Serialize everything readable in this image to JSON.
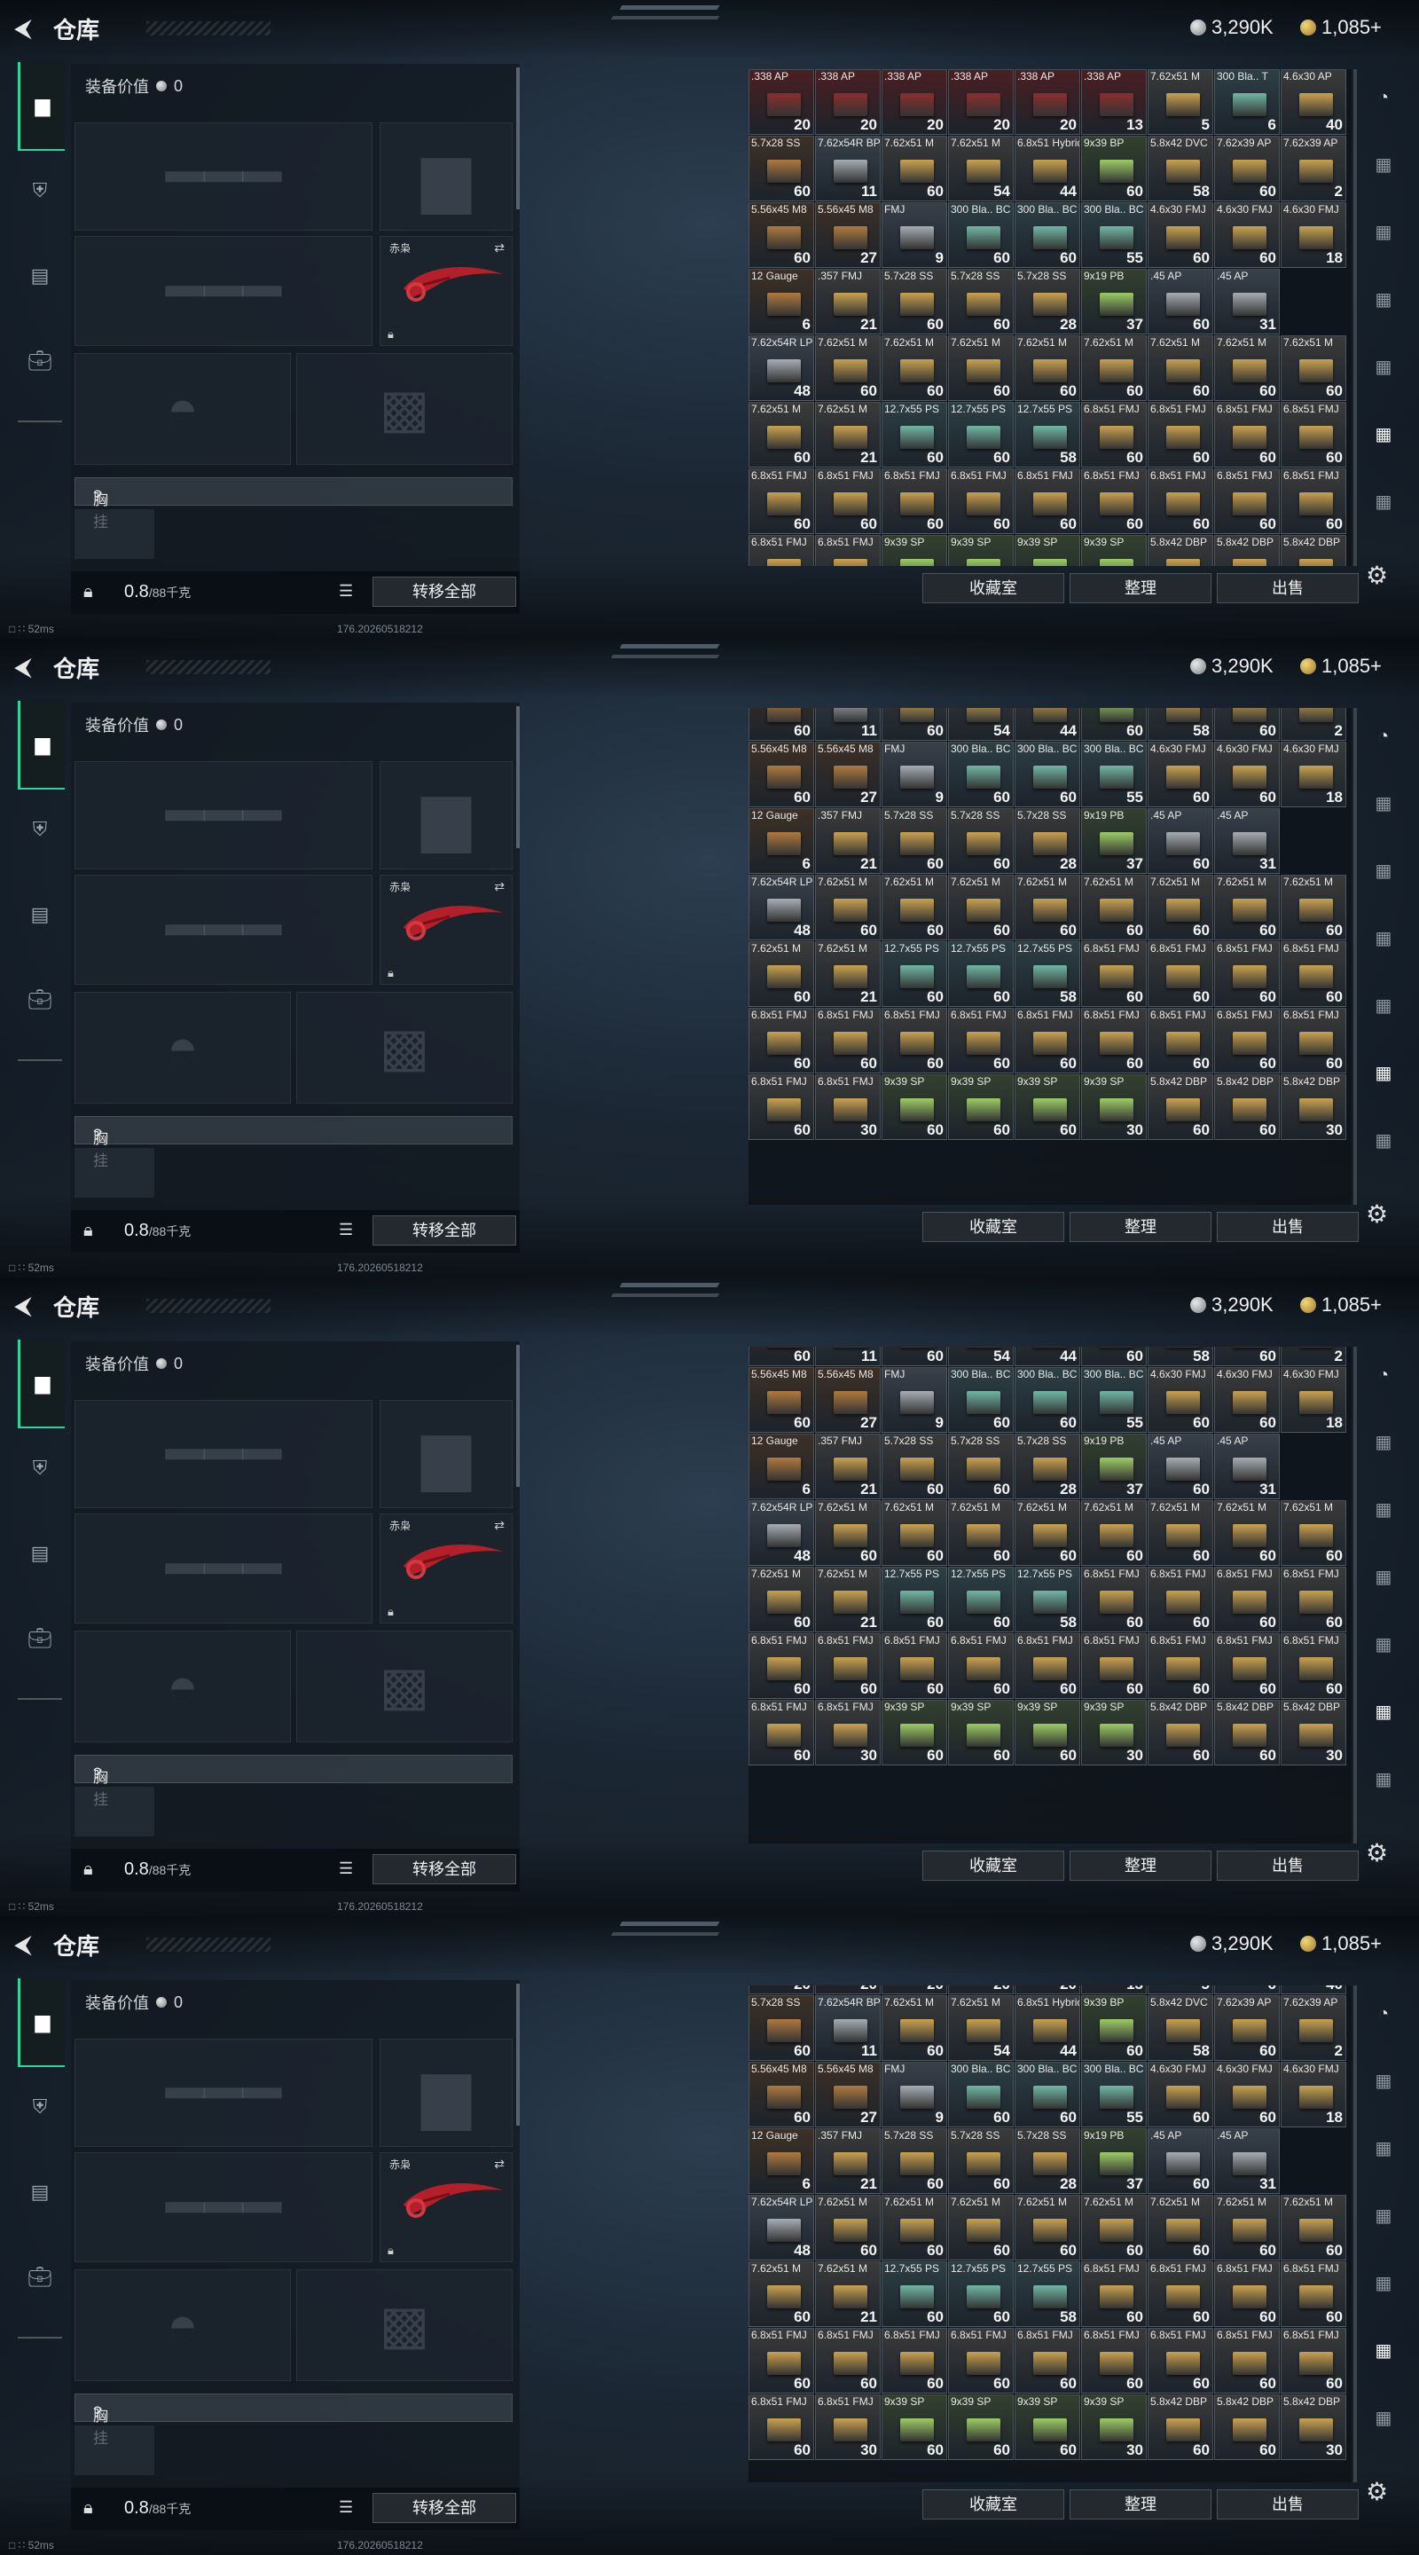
{
  "frames": [
    {
      "title": "仓库",
      "currency": {
        "silver": "3,290K",
        "gold": "1,085+"
      },
      "equipment_value_label": "装备价值",
      "equipment_value": "0",
      "knife_name": "赤枭",
      "chest_label": "胸挂",
      "chest_help": "?",
      "weight": "0.8",
      "weight_max": "/88千克",
      "transfer_all": "转移全部",
      "buttons": {
        "vault": "收藏室",
        "sort": "整理",
        "sell": "出售"
      },
      "ping": "52ms",
      "build": "176.20260518212",
      "grid_offset": 0
    },
    {
      "title": "仓库",
      "currency": {
        "silver": "3,290K",
        "gold": "1,085+"
      },
      "equipment_value_label": "装备价值",
      "equipment_value": "0",
      "knife_name": "赤枭",
      "chest_label": "胸挂",
      "chest_help": "?",
      "weight": "0.8",
      "weight_max": "/88千克",
      "transfer_all": "转移全部",
      "buttons": {
        "vault": "收藏室",
        "sort": "整理",
        "sell": "出售"
      },
      "ping": "52ms",
      "build": "176.20260518212",
      "grid_offset": 1.5
    },
    {
      "title": "仓库",
      "currency": {
        "silver": "3,290K",
        "gold": "1,085+"
      },
      "equipment_value_label": "装备价值",
      "equipment_value": "0",
      "knife_name": "赤枭",
      "chest_label": "胸挂",
      "chest_help": "?",
      "weight": "0.8",
      "weight_max": "/88千克",
      "transfer_all": "转移全部",
      "buttons": {
        "vault": "收藏室",
        "sort": "整理",
        "sell": "出售"
      },
      "ping": "52ms",
      "build": "176.20260518212",
      "grid_offset": 1.7
    },
    {
      "title": "仓库",
      "currency": {
        "silver": "3,290K",
        "gold": "1,085+"
      },
      "equipment_value_label": "装备价值",
      "equipment_value": "0",
      "knife_name": "赤枭",
      "chest_label": "胸挂",
      "chest_help": "?",
      "weight": "0.8",
      "weight_max": "/88千克",
      "transfer_all": "转移全部",
      "buttons": {
        "vault": "收藏室",
        "sort": "整理",
        "sell": "出售"
      },
      "ping": "52ms",
      "build": "176.20260518212",
      "grid_offset": 0.85
    }
  ],
  "stash_rows": [
    [
      {
        "n": ".338 AP",
        "c": "20",
        "k": "red"
      },
      {
        "n": ".338 AP",
        "c": "20",
        "k": "red"
      },
      {
        "n": ".338 AP",
        "c": "20",
        "k": "red"
      },
      {
        "n": ".338 AP",
        "c": "20",
        "k": "red"
      },
      {
        "n": ".338 AP",
        "c": "20",
        "k": "red"
      },
      {
        "n": ".338 AP",
        "c": "13",
        "k": "red"
      },
      {
        "n": "7.62x51 M",
        "c": "5",
        "k": "tan"
      },
      {
        "n": "300 Bla.. T",
        "c": "6",
        "k": "teal"
      },
      {
        "n": "4.6x30 AP",
        "c": "40",
        "k": "tan"
      }
    ],
    [
      {
        "n": "5.7x28 SS",
        "c": "60",
        "k": "brown"
      },
      {
        "n": "7.62x54R BP",
        "c": "11",
        "k": "gray"
      },
      {
        "n": "7.62x51 M",
        "c": "60",
        "k": "tan"
      },
      {
        "n": "7.62x51 M",
        "c": "54",
        "k": "tan"
      },
      {
        "n": "6.8x51 Hybrid",
        "c": "44",
        "k": "tan"
      },
      {
        "n": "9x39 BP",
        "c": "60",
        "k": "green"
      },
      {
        "n": "5.8x42 DVC",
        "c": "58",
        "k": "tan"
      },
      {
        "n": "7.62x39 AP",
        "c": "60",
        "k": "tan"
      },
      {
        "n": "7.62x39 AP",
        "c": "2",
        "k": "tan"
      }
    ],
    [
      {
        "n": "5.56x45 M8",
        "c": "60",
        "k": "brown"
      },
      {
        "n": "5.56x45 M8",
        "c": "27",
        "k": "brown"
      },
      {
        "n": "FMJ",
        "c": "9",
        "k": "gray"
      },
      {
        "n": "300 Bla.. BC",
        "c": "60",
        "k": "teal"
      },
      {
        "n": "300 Bla.. BC",
        "c": "60",
        "k": "teal"
      },
      {
        "n": "300 Bla.. BC",
        "c": "55",
        "k": "teal"
      },
      {
        "n": "4.6x30 FMJ",
        "c": "60",
        "k": "tan"
      },
      {
        "n": "4.6x30 FMJ",
        "c": "60",
        "k": "tan"
      },
      {
        "n": "4.6x30 FMJ",
        "c": "18",
        "k": "tan"
      }
    ],
    [
      {
        "n": "12 Gauge",
        "c": "6",
        "k": "brown"
      },
      {
        "n": ".357 FMJ",
        "c": "21",
        "k": "tan"
      },
      {
        "n": "5.7x28 SS",
        "c": "60",
        "k": "tan"
      },
      {
        "n": "5.7x28 SS",
        "c": "60",
        "k": "tan"
      },
      {
        "n": "5.7x28 SS",
        "c": "28",
        "k": "tan"
      },
      {
        "n": "9x19 PB",
        "c": "37",
        "k": "green"
      },
      {
        "n": ".45 AP",
        "c": "60",
        "k": "gray"
      },
      {
        "n": ".45 AP",
        "c": "31",
        "k": "gray"
      }
    ],
    [
      {
        "n": "7.62x54R LP",
        "c": "48",
        "k": "gray"
      },
      {
        "n": "7.62x51 M",
        "c": "60",
        "k": "tan"
      },
      {
        "n": "7.62x51 M",
        "c": "60",
        "k": "tan"
      },
      {
        "n": "7.62x51 M",
        "c": "60",
        "k": "tan"
      },
      {
        "n": "7.62x51 M",
        "c": "60",
        "k": "tan"
      },
      {
        "n": "7.62x51 M",
        "c": "60",
        "k": "tan"
      },
      {
        "n": "7.62x51 M",
        "c": "60",
        "k": "tan"
      },
      {
        "n": "7.62x51 M",
        "c": "60",
        "k": "tan"
      },
      {
        "n": "7.62x51 M",
        "c": "60",
        "k": "tan"
      }
    ],
    [
      {
        "n": "7.62x51 M",
        "c": "60",
        "k": "tan"
      },
      {
        "n": "7.62x51 M",
        "c": "21",
        "k": "tan"
      },
      {
        "n": "12.7x55 PS",
        "c": "60",
        "k": "teal"
      },
      {
        "n": "12.7x55 PS",
        "c": "60",
        "k": "teal"
      },
      {
        "n": "12.7x55 PS",
        "c": "58",
        "k": "teal"
      },
      {
        "n": "6.8x51 FMJ",
        "c": "60",
        "k": "tan"
      },
      {
        "n": "6.8x51 FMJ",
        "c": "60",
        "k": "tan"
      },
      {
        "n": "6.8x51 FMJ",
        "c": "60",
        "k": "tan"
      },
      {
        "n": "6.8x51 FMJ",
        "c": "60",
        "k": "tan"
      }
    ],
    [
      {
        "n": "6.8x51 FMJ",
        "c": "60",
        "k": "tan"
      },
      {
        "n": "6.8x51 FMJ",
        "c": "60",
        "k": "tan"
      },
      {
        "n": "6.8x51 FMJ",
        "c": "60",
        "k": "tan"
      },
      {
        "n": "6.8x51 FMJ",
        "c": "60",
        "k": "tan"
      },
      {
        "n": "6.8x51 FMJ",
        "c": "60",
        "k": "tan"
      },
      {
        "n": "6.8x51 FMJ",
        "c": "60",
        "k": "tan"
      },
      {
        "n": "6.8x51 FMJ",
        "c": "60",
        "k": "tan"
      },
      {
        "n": "6.8x51 FMJ",
        "c": "60",
        "k": "tan"
      },
      {
        "n": "6.8x51 FMJ",
        "c": "60",
        "k": "tan"
      }
    ],
    [
      {
        "n": "6.8x51 FMJ",
        "c": "60",
        "k": "tan"
      },
      {
        "n": "6.8x51 FMJ",
        "c": "30",
        "k": "tan"
      },
      {
        "n": "9x39 SP",
        "c": "60",
        "k": "green"
      },
      {
        "n": "9x39 SP",
        "c": "60",
        "k": "green"
      },
      {
        "n": "9x39 SP",
        "c": "60",
        "k": "green"
      },
      {
        "n": "9x39 SP",
        "c": "30",
        "k": "green"
      },
      {
        "n": "5.8x42 DBP",
        "c": "60",
        "k": "tan"
      },
      {
        "n": "5.8x42 DBP",
        "c": "60",
        "k": "tan"
      },
      {
        "n": "5.8x42 DBP",
        "c": "30",
        "k": "tan"
      }
    ]
  ],
  "box_colors": {
    "red": "#8a2e2e",
    "tan": "#c9a24f",
    "gray": "#a7adb3",
    "teal": "#6fb7a4",
    "green": "#9ccc65",
    "brown": "#b07a3e"
  },
  "cell_bg": {
    "red": "#4a1f22",
    "tan": "#3a3a3a",
    "gray": "#38404a",
    "teal": "#2d3f45",
    "green": "#33402e",
    "brown": "#3d3026"
  }
}
